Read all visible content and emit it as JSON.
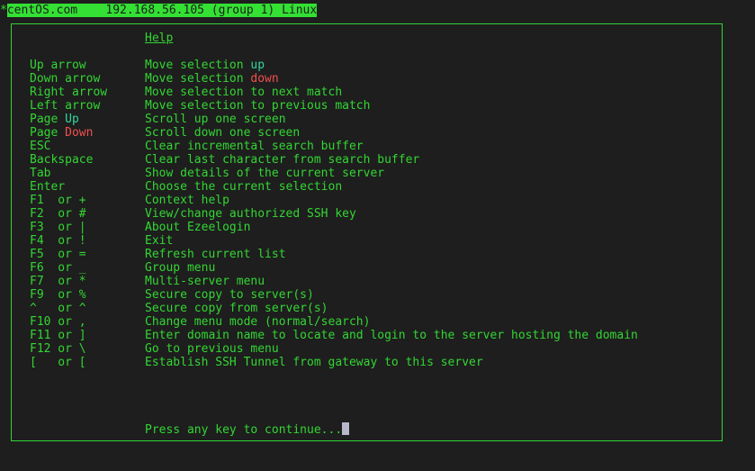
{
  "titlebar": {
    "marker": "*",
    "host": "centOS.com    192.168.56.105 (group 1) Linux"
  },
  "help": {
    "title": "Help",
    "rows": [
      {
        "key": "Up arrow",
        "key_pre": "",
        "key_hl": "",
        "desc_pre": "Move selection ",
        "desc_hl": "up",
        "desc_hl_color": "cyan"
      },
      {
        "key": "Down arrow",
        "desc_pre": "Move selection ",
        "desc_hl": "down",
        "desc_hl_color": "red"
      },
      {
        "key": "Right arrow",
        "desc_pre": "Move selection to next match"
      },
      {
        "key": "Left arrow",
        "desc_pre": "Move selection to previous match"
      },
      {
        "key_pre": "Page ",
        "key_hl": "Up",
        "key_hl_color": "cyan",
        "desc_pre": "Scroll up one screen"
      },
      {
        "key_pre": "Page ",
        "key_hl": "Down",
        "key_hl_color": "red",
        "desc_pre": "Scroll down one screen"
      },
      {
        "key": "ESC",
        "desc_pre": "Clear incremental search buffer"
      },
      {
        "key": "Backspace",
        "desc_pre": "Clear last character from search buffer"
      },
      {
        "key": "Tab",
        "desc_pre": "Show details of the current server"
      },
      {
        "key": "Enter",
        "desc_pre": "Choose the current selection"
      },
      {
        "key": "F1  or +",
        "desc_pre": "Context help"
      },
      {
        "key": "F2  or #",
        "desc_pre": "View/change authorized SSH key"
      },
      {
        "key": "F3  or |",
        "desc_pre": "About Ezeelogin"
      },
      {
        "key": "F4  or !",
        "desc_pre": "Exit"
      },
      {
        "key": "F5  or =",
        "desc_pre": "Refresh current list"
      },
      {
        "key": "F6  or _",
        "desc_pre": "Group menu"
      },
      {
        "key": "F7  or *",
        "desc_pre": "Multi-server menu"
      },
      {
        "key": "F9  or %",
        "desc_pre": "Secure copy to server(s)"
      },
      {
        "key": "^   or ^",
        "desc_pre": "Secure copy from server(s)"
      },
      {
        "key": "F10 or ,",
        "desc_pre": "Change menu mode (normal/search)"
      },
      {
        "key": "F11 or ]",
        "desc_pre": "Enter domain name to locate and login to the server hosting the domain"
      },
      {
        "key": "F12 or \\",
        "desc_pre": "Go to previous menu"
      },
      {
        "key": "[   or [",
        "desc_pre": "Establish SSH Tunnel from gateway to this server"
      }
    ],
    "prompt": "Press any key to continue..."
  },
  "colors": {
    "text": "#33d633",
    "background": "#1e1e1e",
    "highlight_cyan": "#2fd6a0",
    "highlight_red": "#f05050",
    "cursor": "#b8b8c8"
  }
}
